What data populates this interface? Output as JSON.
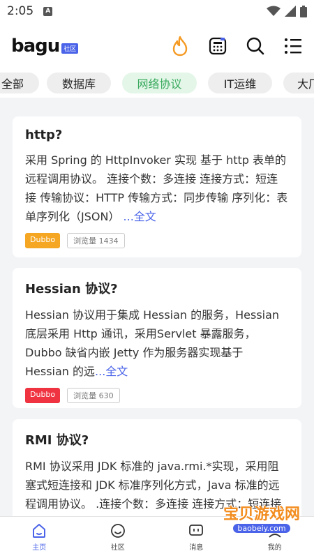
{
  "status_bar": {
    "time": "2:05",
    "notification_letter": "A"
  },
  "header": {
    "logo_text": "bagu",
    "logo_badge": "社区",
    "icons": [
      "fire-icon",
      "calculator-icon",
      "search-icon",
      "menu-icon"
    ]
  },
  "tabs": [
    {
      "label": "全部",
      "active": false
    },
    {
      "label": "数据库",
      "active": false
    },
    {
      "label": "网络协议",
      "active": true
    },
    {
      "label": "IT运维",
      "active": false
    },
    {
      "label": "大厂",
      "active": false
    }
  ],
  "cards": [
    {
      "title": "http?",
      "body": "采用 Spring 的 HttpInvoker 实现 基于 http 表单的远程调用协议。 连接个数：多连接 连接方式：短连接 传输协议：HTTP 传输方式：同步传输 序列化：表单序列化（JSON）",
      "more": "...全文",
      "tag": "Dubbo",
      "tag_color": "#f5a623",
      "views": "浏览量 1434"
    },
    {
      "title": "Hessian 协议?",
      "body": "Hessian 协议用于集成 Hessian 的服务，Hessian 底层采用 Http 通讯，采用Servlet 暴露服务，Dubbo 缺省内嵌 Jetty 作为服务器实现基于 Hessian 的远",
      "more": "...全文",
      "tag": "Dubbo",
      "tag_color": "#ef3340",
      "views": "浏览量 630"
    },
    {
      "title": "RMI 协议?",
      "body": "RMI 协议采用 JDK 标准的 java.rmi.*实现，采用阻塞式短连接和 JDK 标准序列化方式，Java 标准的远程调用协议。 .连接个数：多连接 连接方式：短连接 传输协议：TCP 传",
      "more": "",
      "tag": "",
      "tag_color": "",
      "views": ""
    }
  ],
  "bottom_nav": [
    {
      "label": "主页",
      "icon": "home-icon",
      "active": true
    },
    {
      "label": "社区",
      "icon": "smile-icon",
      "active": false
    },
    {
      "label": "消息",
      "icon": "message-icon",
      "active": false
    },
    {
      "label": "我的",
      "icon": "user-icon",
      "active": false
    }
  ],
  "watermark": {
    "title": "宝贝游戏网",
    "sub": "baobeiy.com"
  },
  "colors": {
    "accent": "#4a63e8",
    "active_tab_bg": "#e3f6e8",
    "active_tab_text": "#3aaa5e"
  }
}
